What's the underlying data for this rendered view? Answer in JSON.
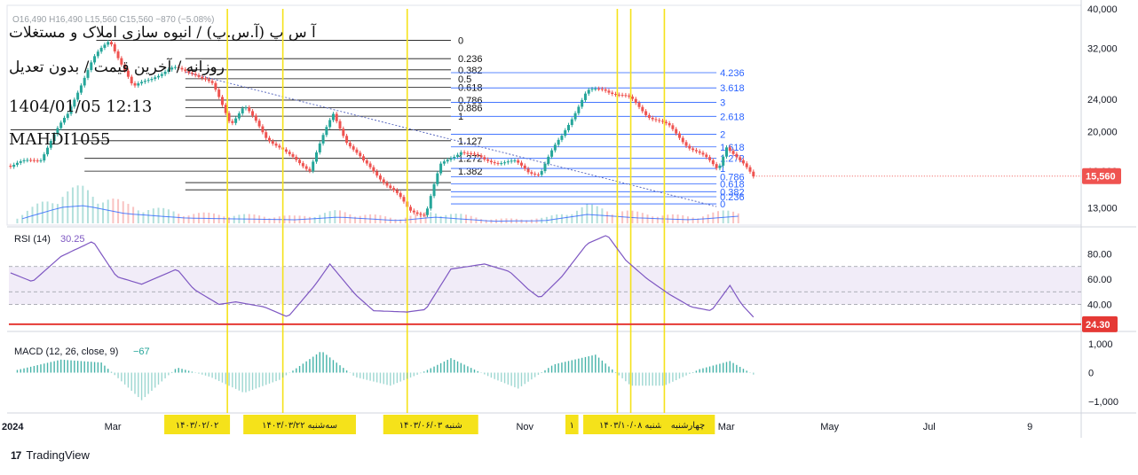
{
  "header": {
    "ohlc_text": "O16,490 H16,490 L15,560 C15,560 −870 (−5.08%)",
    "symbol_title": "آ س پ (آ.س.پ) / انبوه سازی املاک و مستغلات",
    "timeframe_text": "روزانه / آخرین قیمت / بدون تعدیل",
    "datetime_text": "1404/01/05 12:13",
    "author_text": "MAHDI1055"
  },
  "footer": {
    "brand": "TradingView",
    "logo_glyph": "17"
  },
  "colors": {
    "up": "#26a69a",
    "down": "#ef5350",
    "fib": "#2962ff",
    "rsi": "#7e57c2",
    "rsi_band": "#ede7f6",
    "vline": "#f5e21a",
    "hline_red": "#e53935",
    "trend": "#5c6bc0"
  },
  "chart_data": [
    {
      "type": "candlestick",
      "title": "",
      "x_axis": {
        "ticks": [
          "2024",
          "Mar",
          "Nov",
          "Mar",
          "May",
          "Jul",
          "9"
        ]
      },
      "y_axis": {
        "scale": "log",
        "ticks": [
          40000,
          32000,
          24000,
          20000,
          16000,
          13000
        ],
        "ylim": [
          11800,
          40000
        ]
      },
      "last_price": 15560,
      "last_price_label": "15,560",
      "price_path": [
        {
          "x": "2024-01-02",
          "y": 16500
        },
        {
          "x": "2024-01-20",
          "y": 17200
        },
        {
          "x": "2024-02-05",
          "y": 22000
        },
        {
          "x": "2024-02-20",
          "y": 30000
        },
        {
          "x": "2024-03-01",
          "y": 33500
        },
        {
          "x": "2024-03-15",
          "y": 25500
        },
        {
          "x": "2024-03-28",
          "y": 27500
        },
        {
          "x": "2024-04-08",
          "y": 28500
        },
        {
          "x": "2024-04-20",
          "y": 28000
        },
        {
          "x": "2024-05-01",
          "y": 26000
        },
        {
          "x": "2024-05-12",
          "y": 21000
        },
        {
          "x": "2024-05-20",
          "y": 23000
        },
        {
          "x": "2024-06-02",
          "y": 19500
        },
        {
          "x": "2024-06-15",
          "y": 17500
        },
        {
          "x": "2024-06-28",
          "y": 16200
        },
        {
          "x": "2024-07-05",
          "y": 19000
        },
        {
          "x": "2024-07-12",
          "y": 22000
        },
        {
          "x": "2024-07-20",
          "y": 19000
        },
        {
          "x": "2024-07-30",
          "y": 16800
        },
        {
          "x": "2024-08-10",
          "y": 15300
        },
        {
          "x": "2024-08-18",
          "y": 14200
        },
        {
          "x": "2024-08-26",
          "y": 12800
        },
        {
          "x": "2024-09-05",
          "y": 12600
        },
        {
          "x": "2024-09-14",
          "y": 16500
        },
        {
          "x": "2024-09-26",
          "y": 18000
        },
        {
          "x": "2024-10-10",
          "y": 17000
        },
        {
          "x": "2024-10-28",
          "y": 16800
        },
        {
          "x": "2024-11-05",
          "y": 16000
        },
        {
          "x": "2024-11-12",
          "y": 15800
        },
        {
          "x": "2024-11-25",
          "y": 19500
        },
        {
          "x": "2024-12-10",
          "y": 25000
        },
        {
          "x": "2024-12-20",
          "y": 25500
        },
        {
          "x": "2025-01-05",
          "y": 24000
        },
        {
          "x": "2025-01-15",
          "y": 22000
        },
        {
          "x": "2025-01-28",
          "y": 20500
        },
        {
          "x": "2025-02-08",
          "y": 18500
        },
        {
          "x": "2025-02-20",
          "y": 17000
        },
        {
          "x": "2025-02-26",
          "y": 16200
        },
        {
          "x": "2025-03-03",
          "y": 18500
        },
        {
          "x": "2025-03-10",
          "y": 17000
        },
        {
          "x": "2025-03-19",
          "y": 15560
        }
      ],
      "volume_path": [
        {
          "x": "2024-01-05",
          "y": 0.15
        },
        {
          "x": "2024-02-01",
          "y": 0.9
        },
        {
          "x": "2024-02-15",
          "y": 1.0
        },
        {
          "x": "2024-03-10",
          "y": 0.55
        },
        {
          "x": "2024-04-15",
          "y": 0.3
        },
        {
          "x": "2024-05-15",
          "y": 0.25
        },
        {
          "x": "2024-06-20",
          "y": 0.2
        },
        {
          "x": "2024-07-15",
          "y": 0.35
        },
        {
          "x": "2024-08-20",
          "y": 0.15
        },
        {
          "x": "2024-09-10",
          "y": 0.35
        },
        {
          "x": "2024-10-15",
          "y": 0.12
        },
        {
          "x": "2024-11-15",
          "y": 0.15
        },
        {
          "x": "2024-12-10",
          "y": 0.5
        },
        {
          "x": "2025-01-10",
          "y": 0.3
        },
        {
          "x": "2025-02-10",
          "y": 0.2
        },
        {
          "x": "2025-03-10",
          "y": 0.4
        }
      ],
      "volume_scale": "relative (0–1)",
      "fib_left": {
        "levels": [
          "0",
          "0.236",
          "0.382",
          "0.5",
          "0.618",
          "0.786",
          "0.886",
          "1",
          "1.127",
          "1.272",
          "1.382"
        ],
        "prices": [
          33500,
          30200,
          28350,
          26960,
          25670,
          23900,
          22880,
          21820,
          19000,
          17200,
          16000
        ]
      },
      "fib_left_lines": [
        {
          "level": "0",
          "y": 33500,
          "x0": "2024-02-22",
          "x1": "2024-09-20"
        },
        {
          "level": "0.236",
          "y": 30200,
          "x0": "2024-04-15",
          "x1": "2024-09-20"
        },
        {
          "level": "0.382",
          "y": 28350,
          "x0": "2024-04-15",
          "x1": "2024-09-20"
        },
        {
          "level": "0.5",
          "y": 26960,
          "x0": "2024-04-15",
          "x1": "2024-09-20"
        },
        {
          "level": "0.618",
          "y": 25670,
          "x0": "2024-04-15",
          "x1": "2024-09-20"
        },
        {
          "level": "0.786",
          "y": 23900,
          "x0": "2024-04-15",
          "x1": "2024-09-20"
        },
        {
          "level": "0.886",
          "y": 22880,
          "x0": "2024-04-15",
          "x1": "2024-09-20"
        },
        {
          "level": "1",
          "y": 21820,
          "x0": "2024-04-15",
          "x1": "2024-09-20"
        },
        {
          "level": "1.127",
          "y": 19000,
          "x0": "2024-02-10",
          "x1": "2024-09-20"
        },
        {
          "level": "1.272",
          "y": 17200,
          "x0": "2024-02-15",
          "x1": "2024-09-20"
        },
        {
          "level": "1.382",
          "y": 16000,
          "x0": "2024-02-15",
          "x1": "2024-09-20"
        }
      ],
      "fib_left_extra_lines": [
        {
          "y": 20200,
          "x0": "2024-01-02",
          "x1": "2024-09-20"
        },
        {
          "y": 15000,
          "x0": "2024-04-15",
          "x1": "2024-09-20"
        },
        {
          "y": 14400,
          "x0": "2024-04-15",
          "x1": "2024-09-20"
        }
      ],
      "fib_right": {
        "levels": [
          "4.236",
          "3.618",
          "3",
          "2.618",
          "2",
          "1.618",
          "1.272",
          "1",
          "0.786",
          "0.618",
          "0.382",
          "0.236",
          "0"
        ],
        "prices": [
          27900,
          25600,
          23600,
          21800,
          19700,
          18350,
          17200,
          16250,
          15500,
          14900,
          14250,
          13850,
          13300
        ]
      },
      "fib_right_range": {
        "x0": "2024-09-20",
        "x1": "2025-02-25"
      },
      "trendline": [
        {
          "x": "2024-04-15",
          "y": 28000
        },
        {
          "x": "2025-02-25",
          "y": 13100
        }
      ],
      "vertical_lines": [
        "2024-05-10",
        "2024-06-12",
        "2024-08-25",
        "2024-12-28",
        "2025-01-05",
        "2025-01-25"
      ],
      "xlim": [
        "2024-01-01",
        "2025-09-30"
      ],
      "x_tick_dates": [
        "2024-01-01",
        "2024-03-01",
        "2024-11-01",
        "2025-03-01",
        "2025-05-01",
        "2025-07-01",
        "2025-09-01"
      ]
    },
    {
      "type": "line",
      "title": "RSI (14)",
      "value": "30.25",
      "y_ticks": [
        80,
        60,
        40
      ],
      "ylim": [
        20,
        100
      ],
      "band": [
        40,
        70
      ],
      "midline": 50,
      "bands_labels": [
        "70",
        "50",
        "40"
      ],
      "reference_level": 24.3,
      "reference_label": "24.30",
      "series": [
        {
          "x": "2024-01-02",
          "y": 65
        },
        {
          "x": "2024-01-15",
          "y": 58
        },
        {
          "x": "2024-02-01",
          "y": 78
        },
        {
          "x": "2024-02-20",
          "y": 90
        },
        {
          "x": "2024-03-05",
          "y": 62
        },
        {
          "x": "2024-03-20",
          "y": 56
        },
        {
          "x": "2024-04-10",
          "y": 68
        },
        {
          "x": "2024-04-20",
          "y": 52
        },
        {
          "x": "2024-05-05",
          "y": 40
        },
        {
          "x": "2024-05-15",
          "y": 42
        },
        {
          "x": "2024-06-01",
          "y": 38
        },
        {
          "x": "2024-06-15",
          "y": 30
        },
        {
          "x": "2024-07-01",
          "y": 55
        },
        {
          "x": "2024-07-10",
          "y": 72
        },
        {
          "x": "2024-07-25",
          "y": 48
        },
        {
          "x": "2024-08-05",
          "y": 35
        },
        {
          "x": "2024-08-25",
          "y": 34
        },
        {
          "x": "2024-09-05",
          "y": 36
        },
        {
          "x": "2024-09-20",
          "y": 68
        },
        {
          "x": "2024-10-10",
          "y": 72
        },
        {
          "x": "2024-10-25",
          "y": 66
        },
        {
          "x": "2024-11-05",
          "y": 52
        },
        {
          "x": "2024-11-12",
          "y": 45
        },
        {
          "x": "2024-11-25",
          "y": 62
        },
        {
          "x": "2024-12-10",
          "y": 88
        },
        {
          "x": "2024-12-22",
          "y": 95
        },
        {
          "x": "2025-01-02",
          "y": 75
        },
        {
          "x": "2025-01-15",
          "y": 60
        },
        {
          "x": "2025-01-28",
          "y": 48
        },
        {
          "x": "2025-02-10",
          "y": 38
        },
        {
          "x": "2025-02-22",
          "y": 35
        },
        {
          "x": "2025-03-05",
          "y": 55
        },
        {
          "x": "2025-03-12",
          "y": 40
        },
        {
          "x": "2025-03-19",
          "y": 30
        }
      ]
    },
    {
      "type": "bar",
      "title": "MACD (12, 26, close, 9)",
      "value": "−67",
      "y_ticks": [
        1000,
        0,
        -1000
      ],
      "y_tick_labels": [
        "1,000",
        "0",
        "−1,000"
      ],
      "ylim": [
        -1300,
        1300
      ],
      "histogram_envelope": [
        {
          "x": "2024-01-05",
          "y": 80
        },
        {
          "x": "2024-02-01",
          "y": 450
        },
        {
          "x": "2024-02-25",
          "y": 350
        },
        {
          "x": "2024-03-20",
          "y": -950
        },
        {
          "x": "2024-04-10",
          "y": 180
        },
        {
          "x": "2024-04-30",
          "y": -150
        },
        {
          "x": "2024-05-20",
          "y": -700
        },
        {
          "x": "2024-06-10",
          "y": -250
        },
        {
          "x": "2024-07-05",
          "y": 750
        },
        {
          "x": "2024-07-25",
          "y": -150
        },
        {
          "x": "2024-08-15",
          "y": -450
        },
        {
          "x": "2024-09-01",
          "y": -50
        },
        {
          "x": "2024-09-20",
          "y": 500
        },
        {
          "x": "2024-10-15",
          "y": -200
        },
        {
          "x": "2024-10-30",
          "y": -550
        },
        {
          "x": "2024-11-20",
          "y": 280
        },
        {
          "x": "2024-12-15",
          "y": 620
        },
        {
          "x": "2025-01-05",
          "y": -450
        },
        {
          "x": "2025-01-25",
          "y": -450
        },
        {
          "x": "2025-02-15",
          "y": 120
        },
        {
          "x": "2025-03-05",
          "y": 400
        },
        {
          "x": "2025-03-19",
          "y": -67
        }
      ]
    }
  ],
  "date_labels": [
    {
      "text": "۱۴۰۳/۰۲/۰۲",
      "x": "2024-04-22"
    },
    {
      "text": "سه‌شنبه ۱۴۰۳/۰۳/۲۲",
      "x": "2024-06-22"
    },
    {
      "text": "شنبه ۱۴۰۳/۰۶/۰۳",
      "x": "2024-09-08"
    },
    {
      "text": "۱",
      "x": "2024-12-01"
    },
    {
      "text": "شنبه ۱۴۰۳/۱۰/۰۸",
      "x": "2025-01-05"
    },
    {
      "text": "چهارشنبه",
      "x": "2025-02-08"
    }
  ]
}
